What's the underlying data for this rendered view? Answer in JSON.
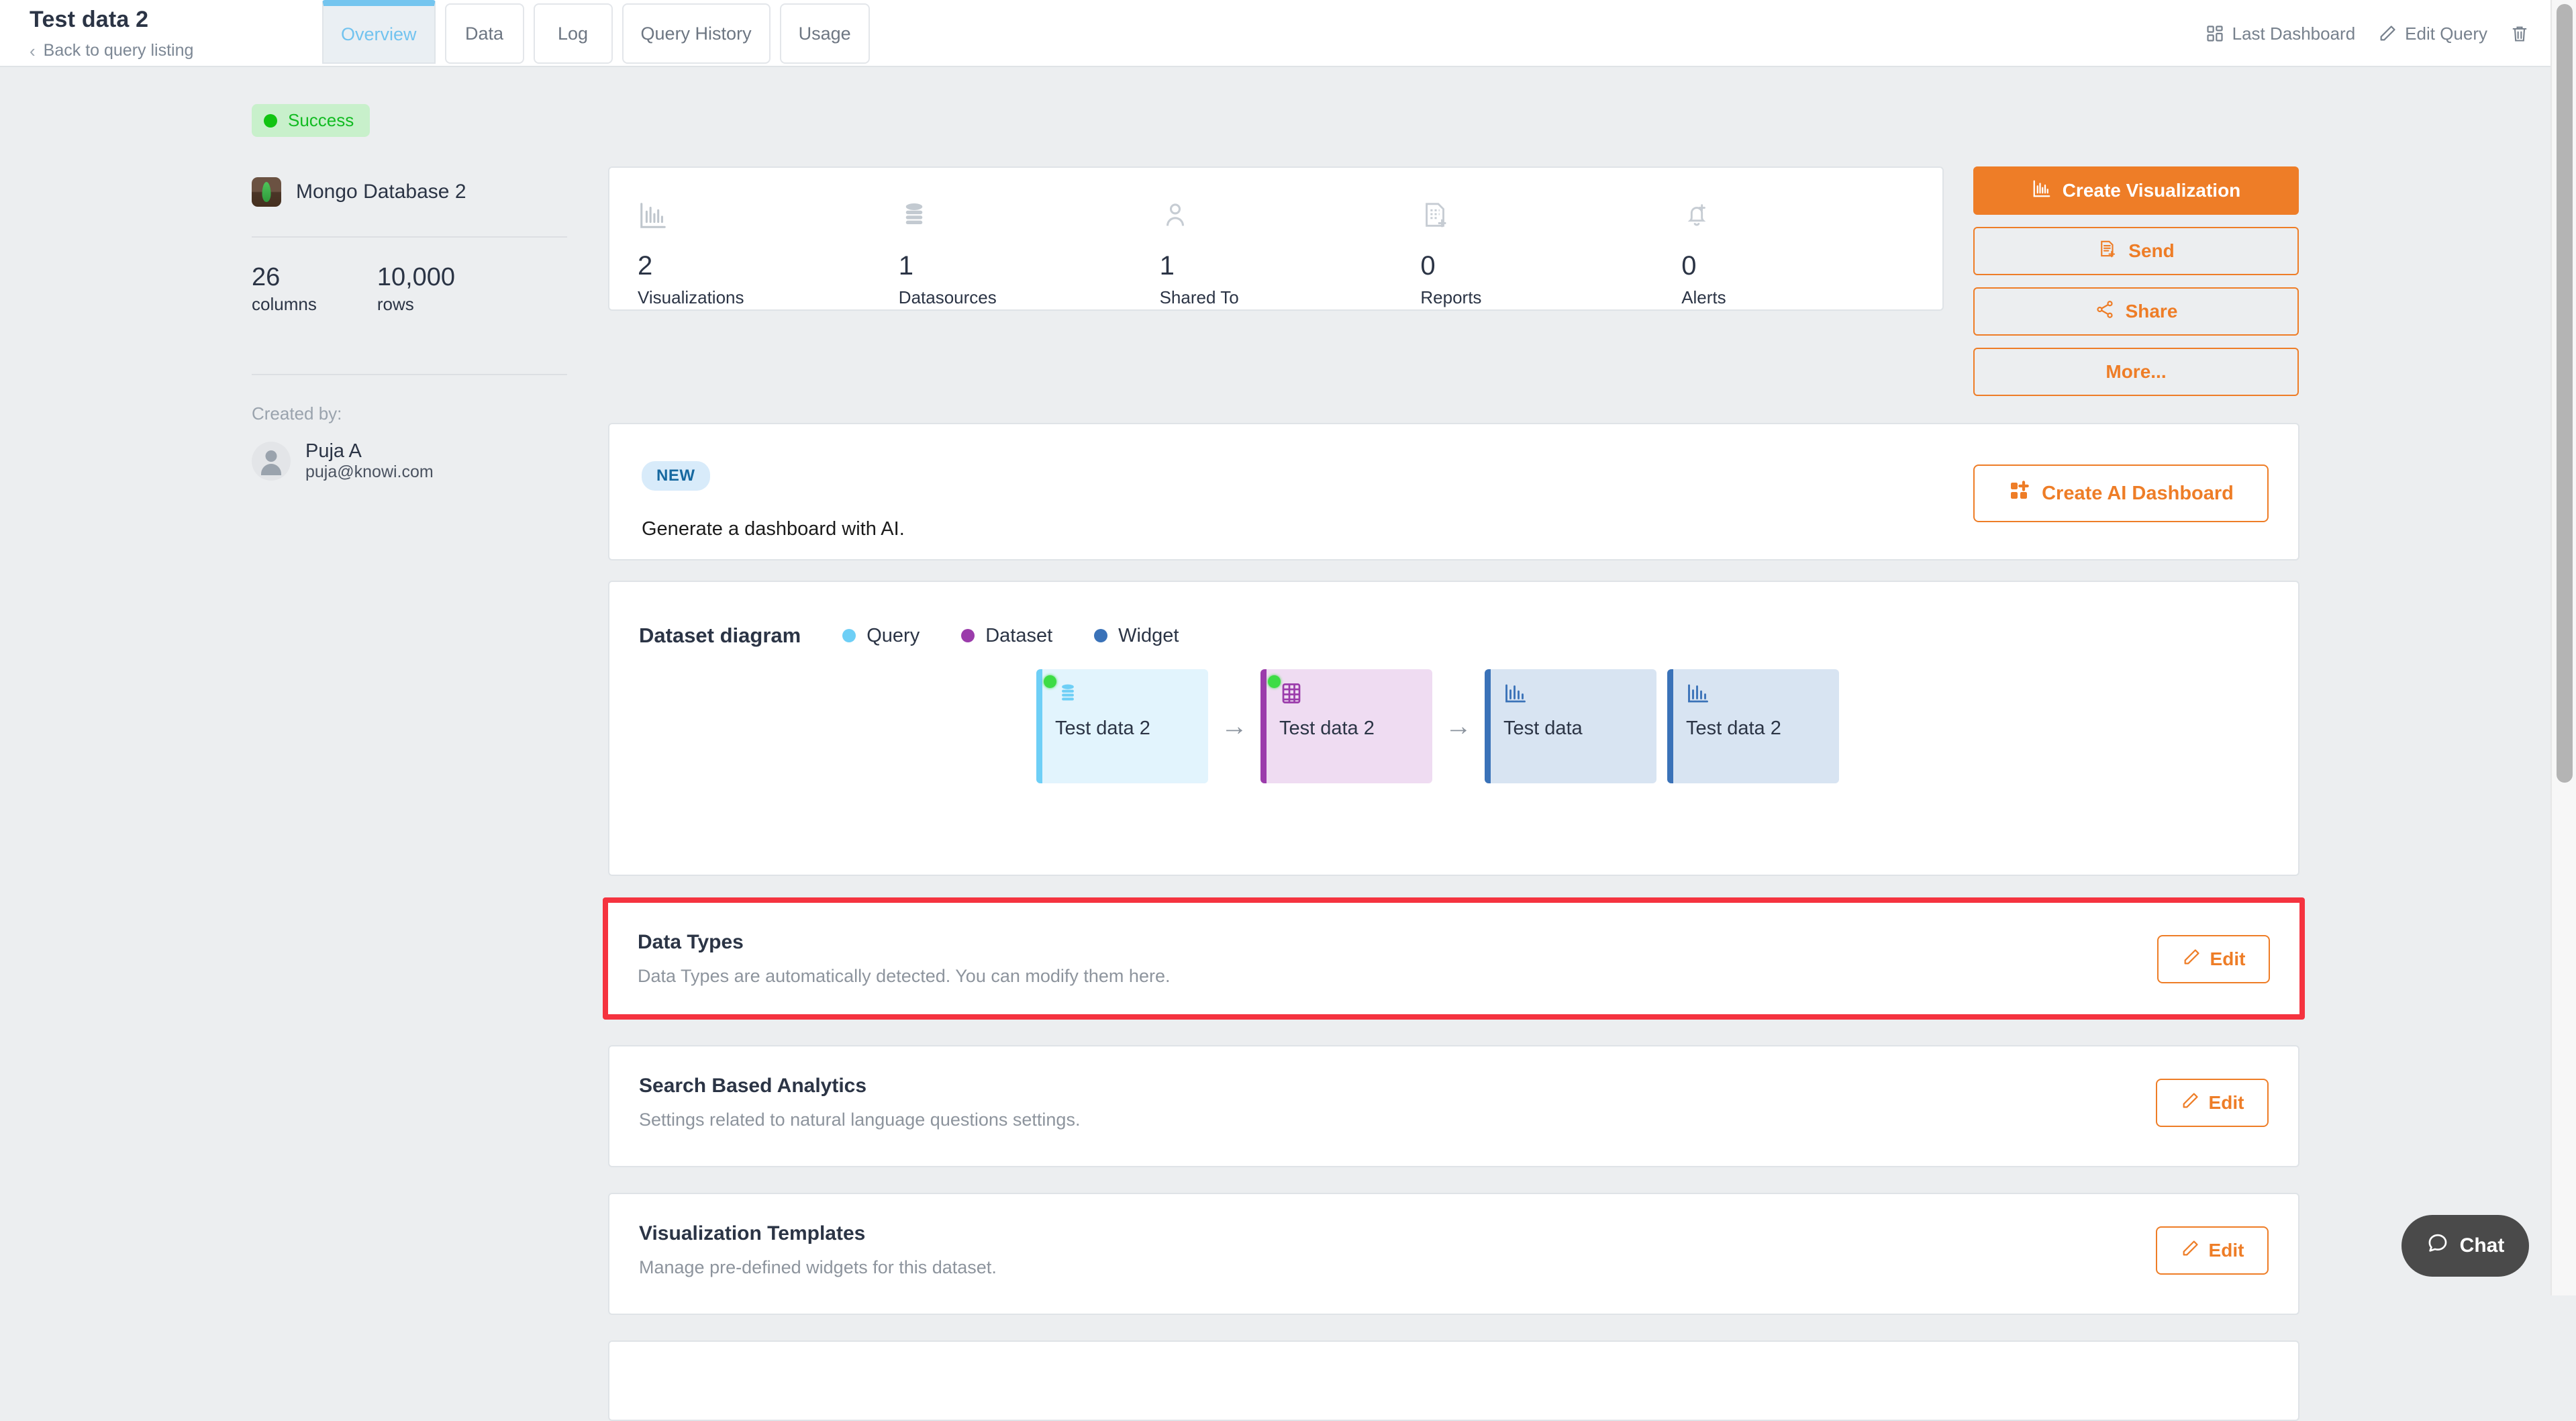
{
  "header": {
    "title": "Test data 2",
    "back_link": "Back to query listing",
    "back_icon": "chevron-left-icon",
    "tabs": [
      {
        "label": "Overview",
        "active": true
      },
      {
        "label": "Data",
        "active": false
      },
      {
        "label": "Log",
        "active": false
      },
      {
        "label": "Query History",
        "active": false
      },
      {
        "label": "Usage",
        "active": false
      }
    ],
    "actions": [
      {
        "label": "Last Dashboard",
        "icon": "dashboard-grid-icon"
      },
      {
        "label": "Edit Query",
        "icon": "pencil-icon"
      },
      {
        "label": "",
        "icon": "trash-icon"
      }
    ]
  },
  "sidebar": {
    "status": {
      "label": "Success",
      "icon": "status-dot-icon",
      "color": "#11c412",
      "bg": "#c8f0cb"
    },
    "datasource": {
      "name": "Mongo Database 2",
      "icon": "mongodb-icon"
    },
    "stats": [
      {
        "value": "26",
        "label": "columns"
      },
      {
        "value": "10,000",
        "label": "rows"
      }
    ],
    "created_by_label": "Created by:",
    "user": {
      "name": "Puja A",
      "email": "puja@knowi.com",
      "avatar": "user-avatar-icon"
    }
  },
  "overview_stats": [
    {
      "value": "2",
      "label": "Visualizations",
      "icon": "bar-chart-icon"
    },
    {
      "value": "1",
      "label": "Datasources",
      "icon": "database-icon"
    },
    {
      "value": "1",
      "label": "Shared To",
      "icon": "person-icon"
    },
    {
      "value": "0",
      "label": "Reports",
      "icon": "report-add-icon"
    },
    {
      "value": "0",
      "label": "Alerts",
      "icon": "bell-add-icon"
    }
  ],
  "action_buttons": [
    {
      "label": "Create Visualization",
      "icon": "bar-chart-icon",
      "style": "primary"
    },
    {
      "label": "Send",
      "icon": "send-report-icon",
      "style": "outline"
    },
    {
      "label": "Share",
      "icon": "share-icon",
      "style": "outline"
    },
    {
      "label": "More...",
      "icon": "",
      "style": "outline"
    }
  ],
  "ai_banner": {
    "badge": "NEW",
    "text": "Generate a dashboard with AI.",
    "button": {
      "label": "Create AI Dashboard",
      "icon": "dashboard-plus-icon"
    }
  },
  "diagram": {
    "title": "Dataset diagram",
    "legend": [
      {
        "label": "Query",
        "color": "#6ecff6"
      },
      {
        "label": "Dataset",
        "color": "#9b3cab"
      },
      {
        "label": "Widget",
        "color": "#3a72b8"
      }
    ],
    "nodes": [
      {
        "label": "Test data 2",
        "type": "Query",
        "icon": "database-icon",
        "bar": "#6ecff6",
        "bg": "#e2f4fd",
        "icon_color": "#6ecff6",
        "led": true
      },
      {
        "label": "Test data 2",
        "type": "Dataset",
        "icon": "grid-table-icon",
        "bar": "#9b3cab",
        "bg": "#efdcf2",
        "icon_color": "#9b3cab",
        "led": true
      },
      {
        "label": "Test data",
        "type": "Widget",
        "icon": "bar-chart-icon",
        "bar": "#3a72b8",
        "bg": "#d8e4f2",
        "icon_color": "#3a72b8",
        "led": false
      },
      {
        "label": "Test data 2",
        "type": "Widget",
        "icon": "bar-chart-icon",
        "bar": "#3a72b8",
        "bg": "#d8e4f2",
        "icon_color": "#3a72b8",
        "led": false
      }
    ],
    "connector": "→"
  },
  "sections": [
    {
      "title": "Data Types",
      "subtitle": "Data Types are automatically detected. You can modify them here.",
      "edit_label": "Edit",
      "highlighted": true
    },
    {
      "title": "Search Based Analytics",
      "subtitle": "Settings related to natural language questions settings.",
      "edit_label": "Edit",
      "highlighted": false
    },
    {
      "title": "Visualization Templates",
      "subtitle": "Manage pre-defined widgets for this dataset.",
      "edit_label": "Edit",
      "highlighted": false
    }
  ],
  "chat": {
    "label": "Chat",
    "icon": "chat-bubble-icon"
  },
  "colors": {
    "accent": "#ee7d27",
    "highlight": "#f5333f",
    "tab_active": "#74c5ef",
    "page_bg": "#eceef0"
  }
}
